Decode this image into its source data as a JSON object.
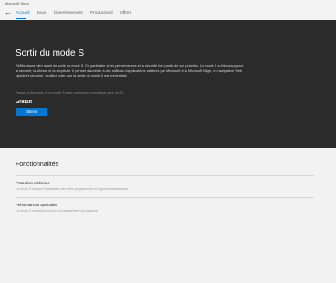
{
  "app": {
    "title": "Microsoft Store"
  },
  "nav": {
    "back_glyph": "←",
    "tabs": [
      {
        "label": "Accueil",
        "active": true
      },
      {
        "label": "Jeux",
        "active": false
      },
      {
        "label": "Divertissement",
        "active": false
      },
      {
        "label": "Productivité",
        "active": false
      },
      {
        "label": "Offres",
        "active": false
      }
    ]
  },
  "hero": {
    "title": "Sortir du mode S",
    "description": "Réfléchissez bien avant de sortir du mode S. En particulier si les performances et la sécurité font partie de vos priorités. Le mode S a été conçu pour la sécurité, la vitesse et la simplicité. Il permet d'accéder à des millions d'applications validées par Microsoft et à Microsoft Edge, un navigateur Web rapide et sécurisé. Veuillez noter que la sortie du mode S est irréversible.",
    "note": "Passez à Windows 10 en mode S avec une licence numérique pour ce PC.",
    "price": "Gratuit",
    "button_label": "Obtenir"
  },
  "features": {
    "title": "Fonctionnalités",
    "items": [
      {
        "name": "Protection renforcée",
        "description": "Le mode S bloque l'installation des sites programmes et logiciels malveillants"
      },
      {
        "name": "Performances optimales",
        "description": "Le mode S maintient au bon fonctionnement du système"
      }
    ]
  },
  "colors": {
    "accent": "#0078d7",
    "hero_bg": "#2b2b2b",
    "page_bg": "#f2f2f2"
  }
}
